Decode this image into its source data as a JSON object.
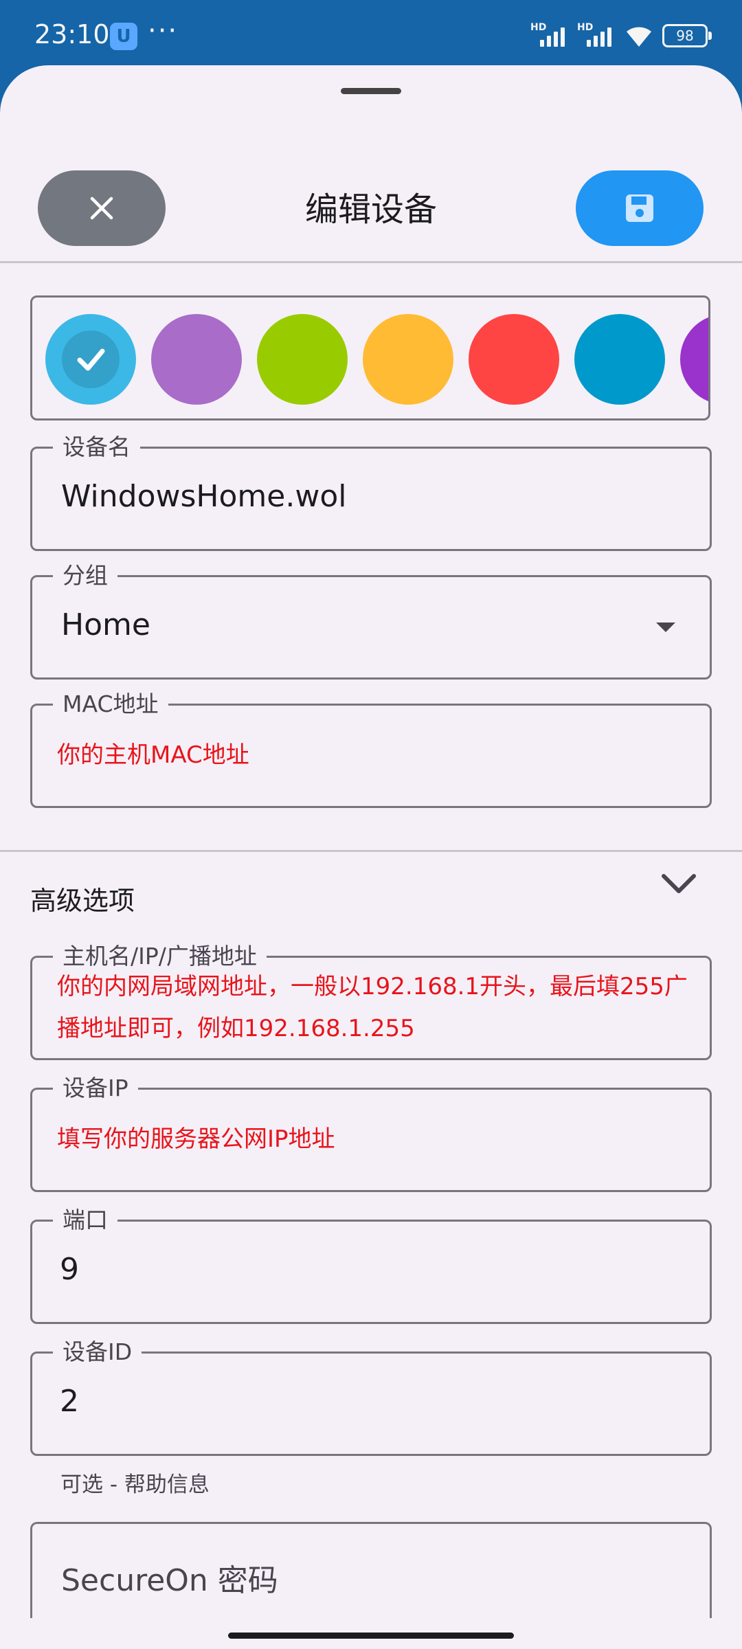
{
  "status_bar": {
    "time": "23:10",
    "app_badge": "U",
    "more": "···",
    "hd1": "HD",
    "hd2": "HD",
    "battery": "98"
  },
  "header": {
    "title": "编辑设备",
    "close_icon": "close-icon",
    "save_icon": "save-icon"
  },
  "colors": {
    "selected": "#3bb8e6",
    "options": [
      "#3bb8e6",
      "#a96cc9",
      "#99cc00",
      "#ffbb33",
      "#ff4444",
      "#0099cc",
      "#9933cc"
    ]
  },
  "form": {
    "device_name": {
      "label": "设备名",
      "value": "WindowsHome.wol"
    },
    "group": {
      "label": "分组",
      "value": "Home"
    },
    "mac": {
      "label": "MAC地址",
      "hint": "你的主机MAC地址"
    }
  },
  "advanced": {
    "title": "高级选项",
    "host": {
      "label": "主机名/IP/广播地址",
      "hint": "你的内网局域网地址，一般以192.168.1开头，最后填255广播地址即可，例如192.168.1.255"
    },
    "device_ip": {
      "label": "设备IP",
      "hint": "填写你的服务器公网IP地址"
    },
    "port": {
      "label": "端口",
      "value": "9"
    },
    "device_id": {
      "label": "设备ID",
      "value": "2"
    },
    "helper": "可选 - 帮助信息",
    "secureon": {
      "placeholder": "SecureOn 密码"
    }
  }
}
